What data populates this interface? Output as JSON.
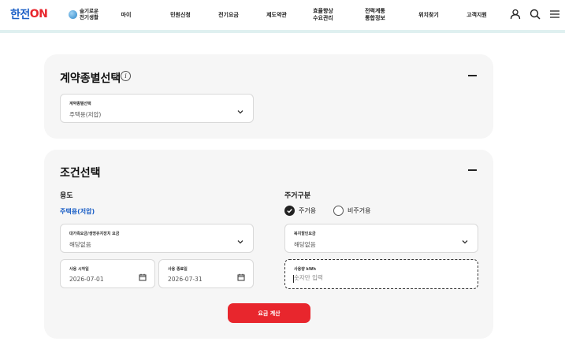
{
  "header": {
    "logo_part1": "한전",
    "logo_part2": "ON",
    "eco_line1": "슬기로운",
    "eco_line2": "전기생활",
    "nav": [
      {
        "label": "마이"
      },
      {
        "label": "민원신청"
      },
      {
        "label": "전기요금"
      },
      {
        "label": "제도약관"
      },
      {
        "label": "효율향상\n수요관리"
      },
      {
        "label": "전력계통\n통합정보"
      },
      {
        "label": "위치찾기"
      },
      {
        "label": "고객지원"
      }
    ]
  },
  "contract_section": {
    "title": "계약종별선택",
    "info_glyph": "i",
    "contract_field": {
      "label": "계약종별선택",
      "value": "주택용(저압)"
    }
  },
  "condition_section": {
    "title": "조건선택",
    "usage_label": "용도",
    "usage_value": "주택용(저압)",
    "large_family_field": {
      "label": "대가족요금/생명유지장치 요금",
      "value": "해당없음"
    },
    "start_date_field": {
      "label": "사용 시작일",
      "value": "2026-07-01"
    },
    "end_date_field": {
      "label": "사용 종료일",
      "value": "2026-07-31"
    },
    "residence_label": "주거구분",
    "radio_residential": {
      "label": "주거용",
      "checked": true
    },
    "radio_non_residential": {
      "label": "비주거용",
      "checked": false
    },
    "welfare_field": {
      "label": "복지할인요금",
      "value": "해당없음"
    },
    "kwh_field": {
      "label": "사용량 kWh",
      "placeholder": "숫자만 입력"
    },
    "calc_button": "요금 계산"
  },
  "colors": {
    "brand_red": "#e8262d",
    "brand_blue": "#1b5fc6",
    "card_bg": "#f6f6f6"
  }
}
